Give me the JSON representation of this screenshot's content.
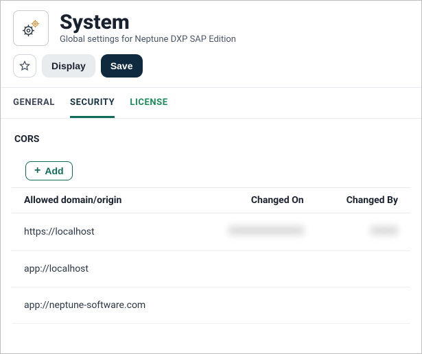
{
  "header": {
    "title": "System",
    "subtitle": "Global settings for Neptune DXP SAP Edition",
    "icon": "gears-icon"
  },
  "actions": {
    "display_label": "Display",
    "save_label": "Save"
  },
  "tabs": {
    "general": "GENERAL",
    "security": "SECURITY",
    "license": "LICENSE",
    "active": "security"
  },
  "cors": {
    "section_title": "CORS",
    "add_label": "Add",
    "columns": {
      "origin": "Allowed domain/origin",
      "changed_on": "Changed On",
      "changed_by": "Changed By"
    },
    "rows": [
      {
        "origin": "https://localhost",
        "changed_on_redacted": true,
        "changed_by_redacted": true
      },
      {
        "origin": "app://localhost",
        "changed_on_redacted": false,
        "changed_by_redacted": false
      },
      {
        "origin": "app://neptune-software.com",
        "changed_on_redacted": false,
        "changed_by_redacted": false
      }
    ]
  }
}
